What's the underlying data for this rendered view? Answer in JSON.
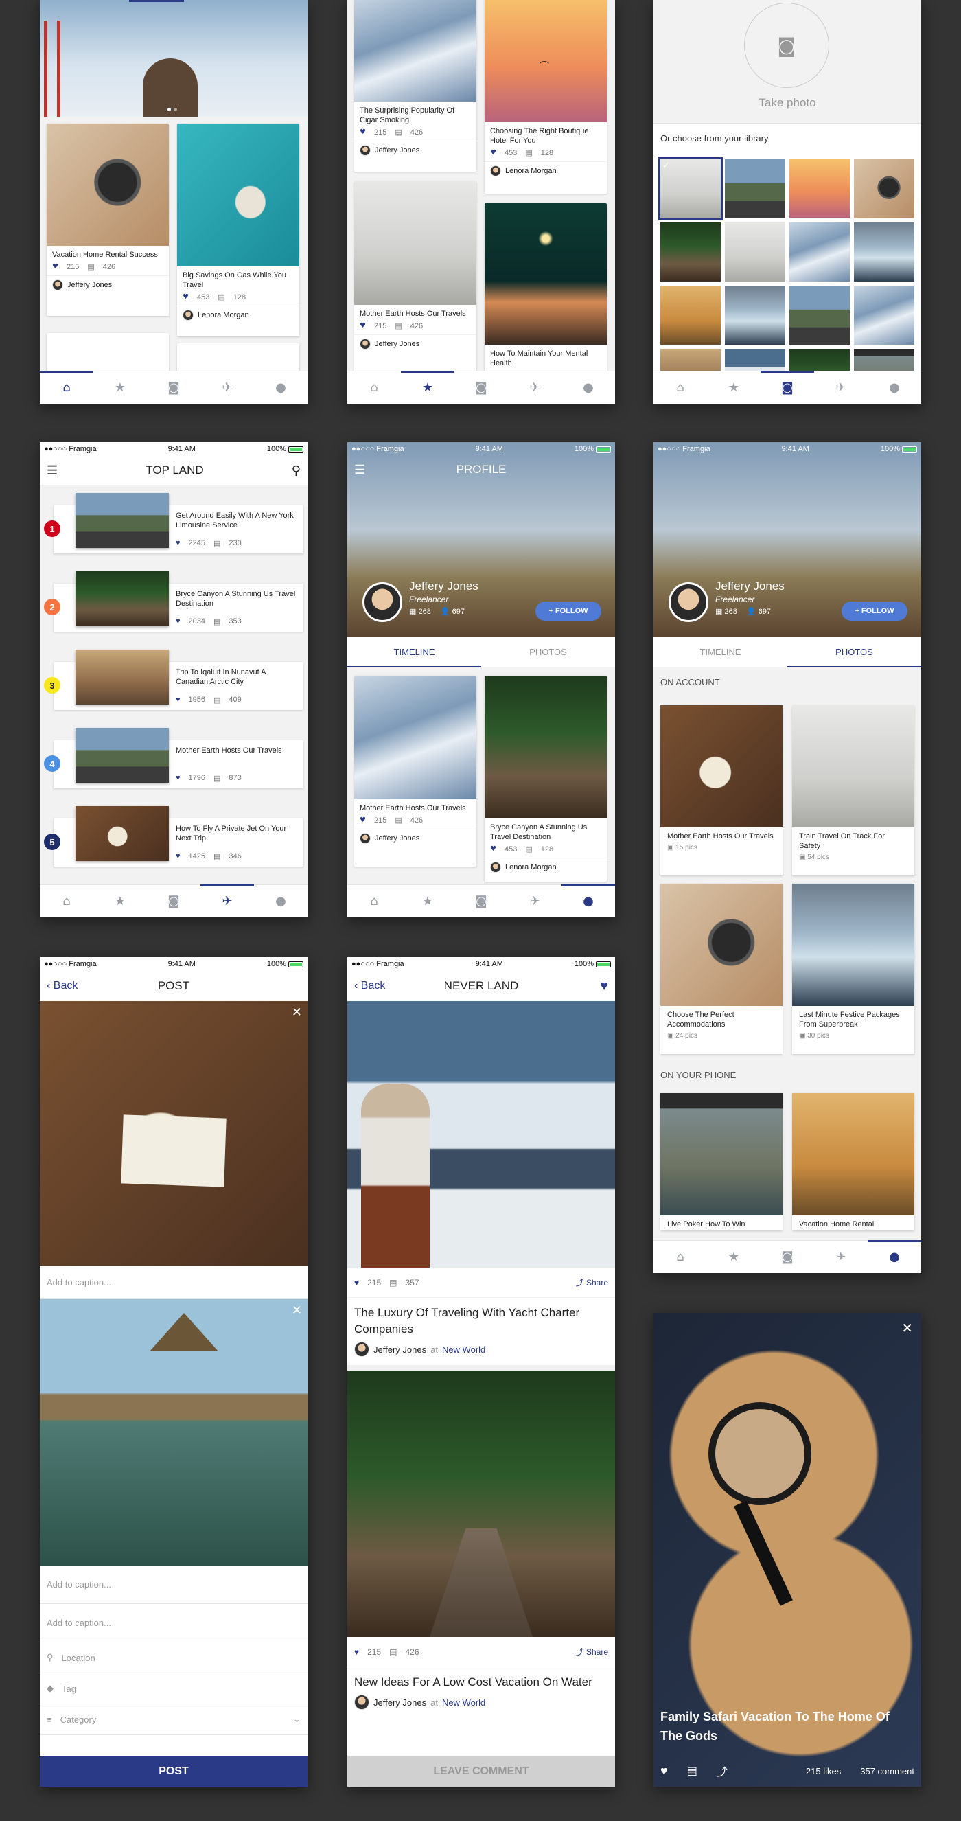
{
  "screen1": {
    "cards": [
      {
        "title": "Vacation Home Rental Success",
        "likes": "215",
        "comments": "426",
        "author": "Jeffery Jones"
      },
      {
        "title": "Big Savings On Gas While You Travel",
        "likes": "453",
        "comments": "128",
        "author": "Lenora Morgan"
      }
    ]
  },
  "screen2": {
    "cards": [
      {
        "title": "The Surprising Popularity Of Cigar Smoking",
        "likes": "215",
        "comments": "426",
        "author": "Jeffery Jones"
      },
      {
        "title": "Choosing The Right Boutique Hotel For You",
        "likes": "453",
        "comments": "128",
        "author": "Lenora Morgan"
      },
      {
        "title": "Mother Earth Hosts Our Travels",
        "likes": "215",
        "comments": "426",
        "author": "Jeffery Jones"
      },
      {
        "title": "How To Maintain Your Mental Health",
        "likes": "",
        "comments": "",
        "author": ""
      }
    ]
  },
  "screen3": {
    "take_photo": "Take photo",
    "library_label": "Or choose from your library"
  },
  "status": {
    "carrier": "●●○○○ Framgia",
    "time": "9:41 AM",
    "battery": "100%"
  },
  "screen4": {
    "title": "TOP LAND",
    "items": [
      {
        "rank": "1",
        "color": "#d0021b",
        "title": "Get Around Easily With A New York Limousine Service",
        "likes": "2245",
        "comments": "230"
      },
      {
        "rank": "2",
        "color": "#f5733f",
        "title": "Bryce Canyon A Stunning Us Travel Destination",
        "likes": "2034",
        "comments": "353"
      },
      {
        "rank": "3",
        "color": "#f8e71c",
        "title": "Trip To Iqaluit In Nunavut A Canadian Arctic City",
        "likes": "1956",
        "comments": "409"
      },
      {
        "rank": "4",
        "color": "#4a90e2",
        "title": "Mother Earth Hosts Our Travels",
        "likes": "1796",
        "comments": "873"
      },
      {
        "rank": "5",
        "color": "#1f2d6b",
        "title": "How To Fly A Private Jet On Your Next Trip",
        "likes": "1425",
        "comments": "346"
      }
    ]
  },
  "screen5": {
    "title": "PROFILE",
    "name": "Jeffery Jones",
    "role": "Freelancer",
    "posts": "268",
    "followers": "697",
    "follow": "+ FOLLOW",
    "tab_timeline": "TIMELINE",
    "tab_photos": "PHOTOS",
    "cards": [
      {
        "title": "Mother Earth Hosts Our Travels",
        "likes": "215",
        "comments": "426",
        "author": "Jeffery Jones"
      },
      {
        "title": "Bryce Canyon A Stunning Us Travel Destination",
        "likes": "453",
        "comments": "128",
        "author": "Lenora Morgan"
      }
    ]
  },
  "screen6": {
    "name": "Jeffery Jones",
    "role": "Freelancer",
    "posts": "268",
    "followers": "697",
    "follow": "+ FOLLOW",
    "tab_timeline": "TIMELINE",
    "tab_photos": "PHOTOS",
    "section1": "ON ACCOUNT",
    "section2": "ON YOUR PHONE",
    "albums": [
      {
        "title": "Mother Earth Hosts Our Travels",
        "count": "15 pics"
      },
      {
        "title": "Train Travel On Track For Safety",
        "count": "54 pics"
      },
      {
        "title": "Choose The Perfect Accommodations",
        "count": "24 pics"
      },
      {
        "title": "Last Minute Festive Packages From Superbreak",
        "count": "30 pics"
      },
      {
        "title": "Live Poker How To Win",
        "count": ""
      },
      {
        "title": "Vacation Home Rental",
        "count": ""
      }
    ]
  },
  "screen7": {
    "back": "Back",
    "title": "POST",
    "caption1": "Add to caption...",
    "caption2": "Add to caption...",
    "caption3": "Add to caption...",
    "location": "Location",
    "tag": "Tag",
    "category": "Category",
    "post_button": "POST"
  },
  "screen8": {
    "back": "Back",
    "title": "NEVER LAND",
    "posts": [
      {
        "likes": "215",
        "comments": "357",
        "share": "Share",
        "title": "The Luxury Of Traveling With Yacht Charter Companies",
        "author": "Jeffery Jones",
        "at": "at",
        "place": "New World"
      },
      {
        "likes": "215",
        "comments": "426",
        "share": "Share",
        "title": "New Ideas For A Low Cost Vacation On Water",
        "author": "Jeffery Jones",
        "at": "at",
        "place": "New World"
      }
    ],
    "leave_comment": "LEAVE COMMENT"
  },
  "screen9": {
    "title": "Family Safari Vacation To The Home Of The Gods",
    "likes": "215 likes",
    "comments": "357 comment"
  },
  "colors": {
    "primary": "#2b3a87",
    "accent": "#4f7ad6",
    "background": "#333333"
  }
}
